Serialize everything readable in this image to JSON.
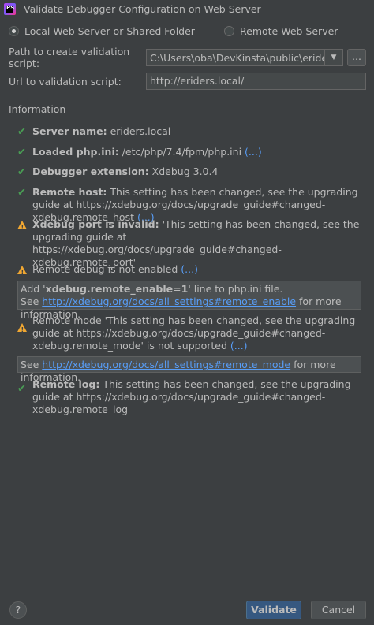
{
  "window": {
    "title": "Validate Debugger Configuration on Web Server"
  },
  "app_icon_label": "PS",
  "server_type": {
    "option_local": "Local Web Server or Shared Folder",
    "option_remote": "Remote Web Server",
    "selected": "local"
  },
  "path_field": {
    "label": "Path to create validation script:",
    "value": "C:\\Users\\oba\\DevKinsta\\public\\eriders\\",
    "browse_label": "..."
  },
  "url_field": {
    "label": "Url to validation script:",
    "value": "http://eriders.local/"
  },
  "information": {
    "heading": "Information",
    "items": [
      {
        "status": "ok",
        "bold": "Server name:",
        "text": " eriders.local",
        "link": ""
      },
      {
        "status": "ok",
        "bold": "Loaded php.ini:",
        "text": " /etc/php/7.4/fpm/php.ini ",
        "link": "(...)"
      },
      {
        "status": "ok",
        "bold": "Debugger extension:",
        "text": " Xdebug 3.0.4",
        "link": ""
      },
      {
        "status": "ok",
        "bold": "Remote host:",
        "text": " This setting has been changed, see the upgrading guide at https://xdebug.org/docs/upgrade_guide#changed-xdebug.remote_host ",
        "link": "(...)"
      },
      {
        "status": "warn",
        "bold": "Xdebug port is invalid:",
        "text": " 'This setting has been changed, see the upgrading guide at https://xdebug.org/docs/upgrade_guide#changed-xdebug.remote_port'",
        "link": ""
      },
      {
        "status": "warn",
        "bold": "",
        "text": "Remote debug is not enabled ",
        "link": "(...)"
      }
    ],
    "note1": {
      "line1_prefix": "Add '",
      "line1_bold": "xdebug.remote_enable",
      "line1_eq": "=",
      "line1_val": "1",
      "line1_suffix": "' line to php.ini file.",
      "line2_prefix": "See ",
      "line2_link": "http://xdebug.org/docs/all_settings#remote_enable",
      "line2_suffix": " for more information."
    },
    "remote_mode": {
      "status": "warn",
      "text": "Remote mode 'This setting has been changed, see the upgrading guide at https://xdebug.org/docs/upgrade_guide#changed-xdebug.remote_mode' is not supported ",
      "link": "(...)"
    },
    "note2": {
      "prefix": "See ",
      "link": "http://xdebug.org/docs/all_settings#remote_mode",
      "suffix": " for more information."
    },
    "remote_log": {
      "status": "ok",
      "bold": "Remote log:",
      "text": " This setting has been changed, see the upgrading guide at https://xdebug.org/docs/upgrade_guide#changed-xdebug.remote_log"
    }
  },
  "buttons": {
    "help": "?",
    "validate": "Validate",
    "cancel": "Cancel"
  },
  "colors": {
    "ok": "#499c54",
    "warn": "#f0a732",
    "link": "#589df6",
    "background": "#3c3f41"
  }
}
